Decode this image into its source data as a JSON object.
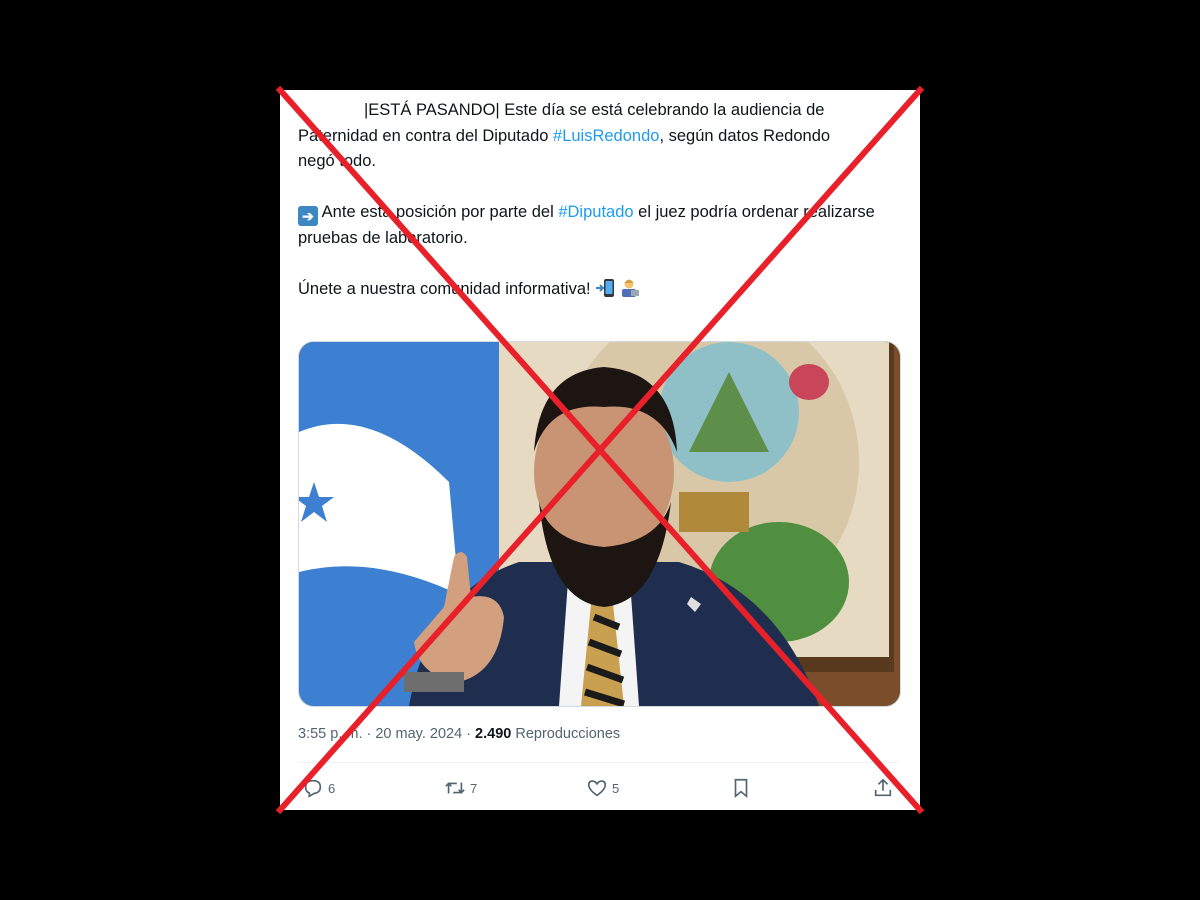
{
  "tweet": {
    "line1_prefix": "|ESTÁ PASANDO| Este día se está celebrando la audiencia de",
    "line2_prefix": "Paternidad en contra del Diputado ",
    "hashtag1": "#LuisRedondo",
    "line2_suffix": ", según datos Redondo",
    "line3": "negó todo.",
    "p2_prefix": " Ante esta posición por parte del ",
    "hashtag2": "#Diputado",
    "p2_suffix": " el juez podría ordenar realizarse pruebas de laboratorio.",
    "p3": "Únete a nuestra comunidad informativa! "
  },
  "meta": {
    "time": "3:55 p. m. · 20 may. 2024 · ",
    "views": "2.490",
    "views_label": " Reproducciones"
  },
  "actions": {
    "replies": "6",
    "retweets": "7",
    "likes": "5"
  },
  "colors": {
    "link": "#1d9bf0",
    "cross": "#e8202a",
    "background": "#000000"
  },
  "icons": [
    "reply-icon",
    "retweet-icon",
    "like-icon",
    "bookmark-icon",
    "share-icon",
    "right-arrow-emoji",
    "mobile-arrow-emoji",
    "technologist-emoji"
  ]
}
